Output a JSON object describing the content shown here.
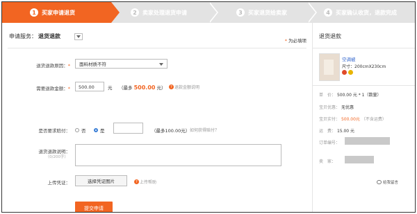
{
  "steps": [
    {
      "num": "1",
      "label": "买家申请退货"
    },
    {
      "num": "2",
      "label": "卖家处理退货申请"
    },
    {
      "num": "3",
      "label": "买家退货给卖家"
    },
    {
      "num": "4",
      "label": "买家确认收货，退款完成"
    }
  ],
  "service": {
    "label": "申请服务：",
    "value": "退货退款"
  },
  "required_note": "为必填项",
  "form": {
    "reason_label": "退货退款原因：",
    "reason_value": "面料材质不符",
    "amount_label": "需要退款金额：",
    "amount_value": "500.00",
    "amount_unit": "元",
    "amount_max_prefix": "（最多",
    "amount_max_value": "500.00",
    "amount_max_suffix": "元）",
    "amount_help": "退款金额说明",
    "compensate_label": "是否要求赔付：",
    "no_label": "否",
    "yes_label": "是",
    "compensate_max": "（最多100.00元）",
    "compensate_how": "如何获得赔付？",
    "desc_label": "退货退款说明：",
    "desc_count": "（0/200字）",
    "upload_label": "上传凭证：",
    "upload_button": "选择凭证图片",
    "upload_help": "上传帮助",
    "submit_button": "提交申请"
  },
  "sidebar": {
    "title": "退货退款",
    "product_name": "空调被",
    "product_size": "尺寸：200cmX230cm",
    "price_label": "单　价：",
    "price_value": "500.00 元 * 1（数量）",
    "discount_label": "宝贝优惠：",
    "discount_value": "无优惠",
    "paid_label": "宝贝实付：",
    "paid_value": "500.00元",
    "paid_note": "（不含运费）",
    "shipping_label": "运　费：",
    "shipping_value": "15.00 元",
    "order_label": "订单编号：",
    "seller_label": "卖　家：",
    "contact_label": "给我留言"
  },
  "colors": {
    "accent": "#f26522",
    "link": "#3366cc"
  }
}
